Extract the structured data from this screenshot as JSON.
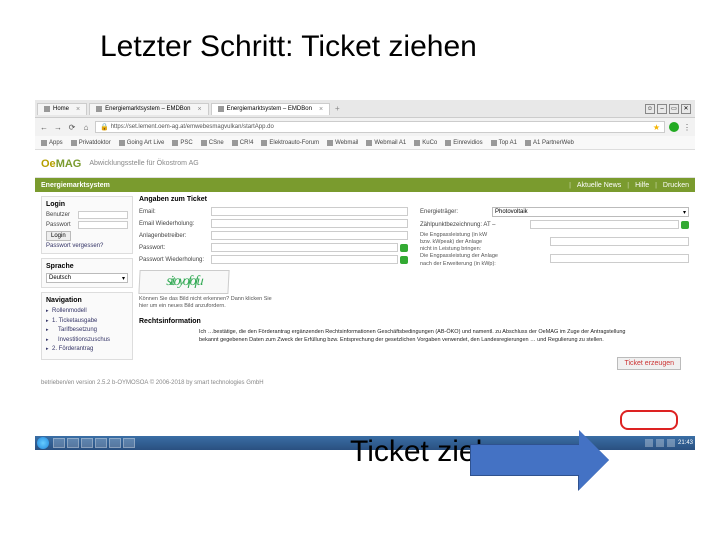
{
  "slide": {
    "title": "Letzter Schritt: Ticket ziehen",
    "callout": "Ticket ziehen"
  },
  "browser": {
    "tabs": [
      {
        "label": "Home"
      },
      {
        "label": "Energiemarktsystem – EMDBon"
      },
      {
        "label": "Energiemarktsystem – EMDBon"
      }
    ],
    "url": "https://set.lement.oem-ag.at/emwebesmagvulkan/startApp.do",
    "bookmarks": [
      "Apps",
      "Privatdoktor",
      "Going Art Live",
      "PSC",
      "CSne",
      "CR!4",
      "Elektroauto-Forum",
      "Webmail",
      "Webmail A1",
      "KuCo",
      "Einrevidios",
      "Top A1",
      "A1 PartnerWeb"
    ]
  },
  "page": {
    "logo_oe": "Oe",
    "logo_mag": "MAG",
    "tagline": "Abwicklungsstelle für Ökostrom AG",
    "greenbar": "Energiemarktsystem",
    "greenbar_links": [
      "Aktuelle News",
      "Hilfe",
      "Drucken"
    ]
  },
  "sidebar": {
    "login_title": "Login",
    "user_label": "Benutzer",
    "pass_label": "Passwort",
    "login_btn": "Login",
    "forgot": "Passwort vergessen?",
    "lang_title": "Sprache",
    "lang_value": "Deutsch",
    "nav_title": "Navigation",
    "nav_items": [
      "Rollenmodell",
      "1. Ticketausgabe",
      "Tarifbesetzung",
      "Investitionszuschus",
      "2. Förderantrag"
    ]
  },
  "form": {
    "heading": "Angaben zum Ticket",
    "col1": {
      "email": "Email:",
      "email2": "Email Wiederholung:",
      "operator": "Anlagenbetreiber:",
      "pass": "Passwort:",
      "pass2": "Passwort Wiederholung:"
    },
    "col2": {
      "type": "Energieträger:",
      "type_val": "Photovoltaik",
      "point": "Zählpunktbezeichnung: AT –",
      "note": "Die Engpassleistung (in kW\nbzw. kWpeak) der Anlage\nnicht in Leistung bringen:\nDie Engpassleistung der Anlage\nnach der Erweiterung (in kWp):"
    },
    "captcha": "sitoyofofu",
    "captcha_help": "Können Sie das Bild nicht erkennen? Dann klicken\nSie hier um ein neues Bild anzufordern.",
    "legal_title": "Rechtsinformation",
    "legal_text": "Ich …bestätige, die den Förderantrag ergänzenden Rechtsinformationen Geschäftsbedingungen (AB-ÖKO) und namentl. zu Abschluss der OeMAG im Zuge der Antragstellung bekannt gegebenen Daten zum Zweck der Erfüllung bzw. Entsprechung der gesetzlichen Vorgaben verwendet, den Landesregierungen … und Regulierung zu stellen.",
    "action_btn": "Ticket erzeugen",
    "footer": "betrieben/en version 2.5.2 b-OYMOSOA © 2006-2018  by smart technologies GmbH"
  },
  "taskbar": {
    "time": "21:43"
  }
}
